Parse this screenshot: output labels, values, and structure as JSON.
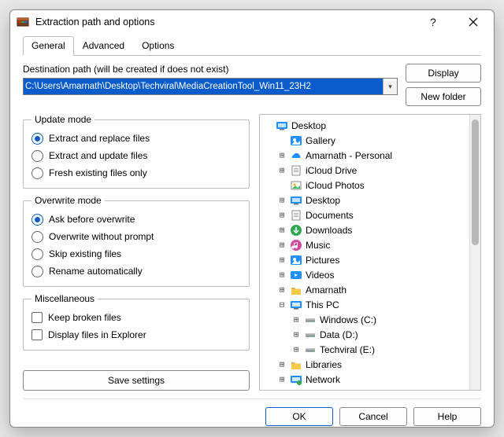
{
  "window": {
    "title": "Extraction path and options"
  },
  "tabs": [
    {
      "label": "General",
      "active": true
    },
    {
      "label": "Advanced",
      "active": false
    },
    {
      "label": "Options",
      "active": false
    }
  ],
  "dest": {
    "label": "Destination path (will be created if does not exist)",
    "value": "C:\\Users\\Amarnath\\Desktop\\Techviral\\MediaCreationTool_Win11_23H2"
  },
  "buttons": {
    "display": "Display",
    "new_folder": "New folder",
    "save_settings": "Save settings",
    "ok": "OK",
    "cancel": "Cancel",
    "help": "Help"
  },
  "groups": {
    "update": {
      "legend": "Update mode",
      "items": [
        {
          "label": "Extract and replace files",
          "checked": true
        },
        {
          "label": "Extract and update files",
          "checked": false
        },
        {
          "label": "Fresh existing files only",
          "checked": false
        }
      ]
    },
    "overwrite": {
      "legend": "Overwrite mode",
      "items": [
        {
          "label": "Ask before overwrite",
          "checked": true
        },
        {
          "label": "Overwrite without prompt",
          "checked": false
        },
        {
          "label": "Skip existing files",
          "checked": false
        },
        {
          "label": "Rename automatically",
          "checked": false
        }
      ]
    },
    "misc": {
      "legend": "Miscellaneous",
      "items": [
        {
          "label": "Keep broken files",
          "checked": false
        },
        {
          "label": "Display files in Explorer",
          "checked": false
        }
      ]
    }
  },
  "tree": [
    {
      "depth": 0,
      "expander": "",
      "icon": "desktop",
      "label": "Desktop"
    },
    {
      "depth": 1,
      "expander": "",
      "icon": "gallery",
      "label": "Gallery"
    },
    {
      "depth": 1,
      "expander": "+",
      "icon": "onedrive",
      "label": "Amarnath - Personal"
    },
    {
      "depth": 1,
      "expander": "+",
      "icon": "doc",
      "label": "iCloud Drive"
    },
    {
      "depth": 1,
      "expander": "",
      "icon": "photos",
      "label": "iCloud Photos"
    },
    {
      "depth": 1,
      "expander": "+",
      "icon": "desktop",
      "label": "Desktop"
    },
    {
      "depth": 1,
      "expander": "+",
      "icon": "doc",
      "label": "Documents"
    },
    {
      "depth": 1,
      "expander": "+",
      "icon": "downloads",
      "label": "Downloads"
    },
    {
      "depth": 1,
      "expander": "+",
      "icon": "music",
      "label": "Music"
    },
    {
      "depth": 1,
      "expander": "+",
      "icon": "pictures",
      "label": "Pictures"
    },
    {
      "depth": 1,
      "expander": "+",
      "icon": "videos",
      "label": "Videos"
    },
    {
      "depth": 1,
      "expander": "+",
      "icon": "folder",
      "label": "Amarnath"
    },
    {
      "depth": 1,
      "expander": "-",
      "icon": "pc",
      "label": "This PC"
    },
    {
      "depth": 2,
      "expander": "+",
      "icon": "drive",
      "label": "Windows (C:)"
    },
    {
      "depth": 2,
      "expander": "+",
      "icon": "drive",
      "label": "Data (D:)"
    },
    {
      "depth": 2,
      "expander": "+",
      "icon": "drive",
      "label": "Techviral (E:)"
    },
    {
      "depth": 1,
      "expander": "+",
      "icon": "folder",
      "label": "Libraries"
    },
    {
      "depth": 1,
      "expander": "+",
      "icon": "network",
      "label": "Network"
    }
  ]
}
